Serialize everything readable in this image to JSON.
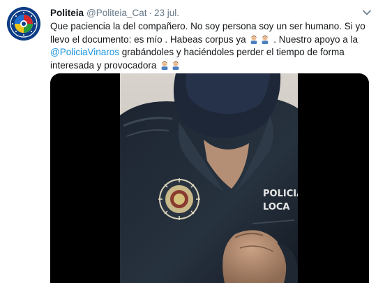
{
  "author": {
    "name": "Politeia",
    "handle": "@Politeia_Cat",
    "separator": "·",
    "date": "23 jul."
  },
  "tweet": {
    "line1": "Que paciencia la del compañero. No soy persona soy un ser humano. Si yo",
    "line2_a": "llevo el documento:  es mío . Habeas corpus ya",
    "line2_b": ". Nuestro apoyo a la",
    "mention": "@PoliciaVinaros",
    "line3_b": " grabándoles y haciéndoles perder el tiempo de forma",
    "line4": "interesada y provocadora"
  },
  "video": {
    "sleeve_text_1": "POLICIA",
    "sleeve_text_2": "LOCA"
  },
  "icons": {
    "caret": "chevron-down-icon",
    "emoji": "man-facepalming-icon"
  },
  "colors": {
    "link": "#1b95e0",
    "muted": "#657786",
    "text": "#14171a",
    "avatar_bg": "#0b3f8a"
  }
}
